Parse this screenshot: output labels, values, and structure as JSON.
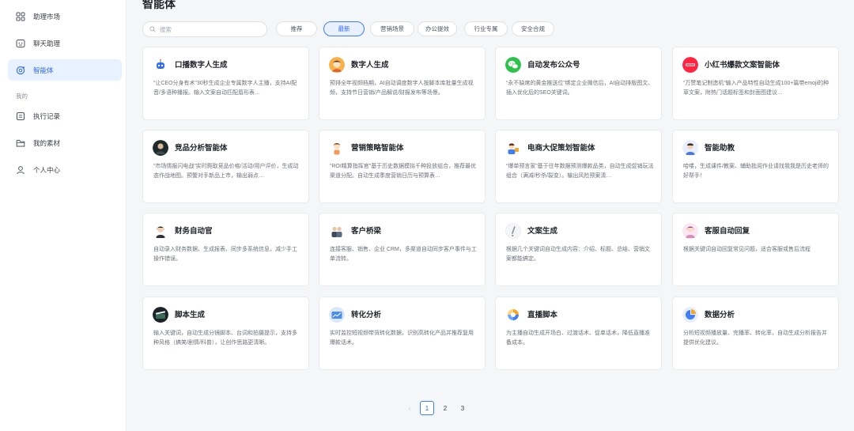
{
  "sidebar": {
    "items": [
      {
        "label": "助理市场",
        "icon": "grid-icon"
      },
      {
        "label": "聊天助理",
        "icon": "chat-bot-icon"
      },
      {
        "label": "智能体",
        "icon": "agent-icon",
        "active": true
      }
    ],
    "section_label": "我的",
    "my_items": [
      {
        "label": "执行记录",
        "icon": "record-icon"
      },
      {
        "label": "我的素材",
        "icon": "folder-icon"
      },
      {
        "label": "个人中心",
        "icon": "user-icon"
      }
    ]
  },
  "main": {
    "title": "智能体",
    "search": {
      "placeholder": "搜索",
      "value": ""
    },
    "filters": [
      "推荐",
      "最新",
      "营销场景",
      "办公提效",
      "行业专属",
      "安全合规"
    ],
    "active_filter": "最新",
    "cards": [
      {
        "title": "口播数字人生成",
        "desc": "“让CEO分身有术”30秒生成企业专属数字人主播，支持AI配音/多语种播报。输入文案自动匹配唇形表…",
        "icon": "robot-avatar-icon"
      },
      {
        "title": "数字人生成",
        "desc": "预排全年视频档期，AI自动调度数字人按脚本库批量生成视频，支持节日营销/产品解说/财报发布等场景。",
        "icon": "person-avatar-icon"
      },
      {
        "title": "自动发布公众号",
        "desc": "“永不缺席的黄金推送位”绑定企业微信后，AI自动排版图文、插入优化后的SEO关键词。",
        "icon": "wechat-icon"
      },
      {
        "title": "小红书爆款文案智能体",
        "desc": "“万赞笔记制造机”输入产品特性自动生成100+篇带emoji的种草文案，附热门话题标签和封面图建议…",
        "icon": "xiaohongshu-icon"
      },
      {
        "title": "竞品分析智能体",
        "desc": "“市场情报闪电战”实时爬取竞品价格/活动/用户评价，生成动态作战地图。预警对手新品上市，输出弱点…",
        "icon": "analyst-avatar-icon"
      },
      {
        "title": "营销策略智能体",
        "desc": "“ROI精算指挥官”基于历史数据模拟千种投放组合，推荐最优渠道分配。自动生成季度营销日历与预算表…",
        "icon": "girl-avatar-icon"
      },
      {
        "title": "电商大促策划智能体",
        "desc": "“爆单预言家”基于往年数据预测爆款品类，自动生成促销玩法组合（满减/秒杀/裂变）。输出风险预案清…",
        "icon": "shopping-avatar-icon"
      },
      {
        "title": "智能助教",
        "desc": "哈喽，生成课件/教案、辅助批阅作业请找我我是历史老师的好帮手！",
        "icon": "teacher-avatar-icon"
      },
      {
        "title": "财务自动官",
        "desc": "自动录入财务数据、生成报表、同步多系统信息，减少手工操作错误。",
        "icon": "finance-avatar-icon"
      },
      {
        "title": "客户桥梁",
        "desc": "连接客服、销售、企业 CRM，多渠道自动同步客户事件与工单流转。",
        "icon": "bridge-avatar-icon"
      },
      {
        "title": "文案生成",
        "desc": "根据几个关键词自动生成内容：介绍、标题、总结、营销文案都能搞定。",
        "icon": "pen-avatar-icon"
      },
      {
        "title": "客服自动回复",
        "desc": "根据关键词自动回复常见问题，适合客服或售后流程",
        "icon": "service-avatar-icon"
      },
      {
        "title": "脚本生成",
        "desc": "输入关键词，自动生成分镜脚本、台词和拍摄提示，支持多种风格（搞笑/剧情/科普），让创作思路更清晰。",
        "icon": "script-avatar-icon"
      },
      {
        "title": "转化分析",
        "desc": "实时监控短视频带货转化数据，识别高转化产品并推荐复用爆款话术。",
        "icon": "conversion-avatar-icon"
      },
      {
        "title": "直播脚本",
        "desc": "为主播自动生成开场白、过渡话术、促单话术，降低直播准备成本。",
        "icon": "live-avatar-icon"
      },
      {
        "title": "数据分析",
        "desc": "分析短视频播放量、完播率、转化率，自动生成分析报告并提供优化建议。",
        "icon": "chart-avatar-icon"
      }
    ],
    "pagination": {
      "pages": [
        "1",
        "2",
        "3"
      ],
      "current": "1",
      "prev_glyph": "‹"
    }
  },
  "colors": {
    "accent": "#2e6bf0",
    "active_bg": "#e8f1ff",
    "page_bg": "#f5f6f8"
  }
}
